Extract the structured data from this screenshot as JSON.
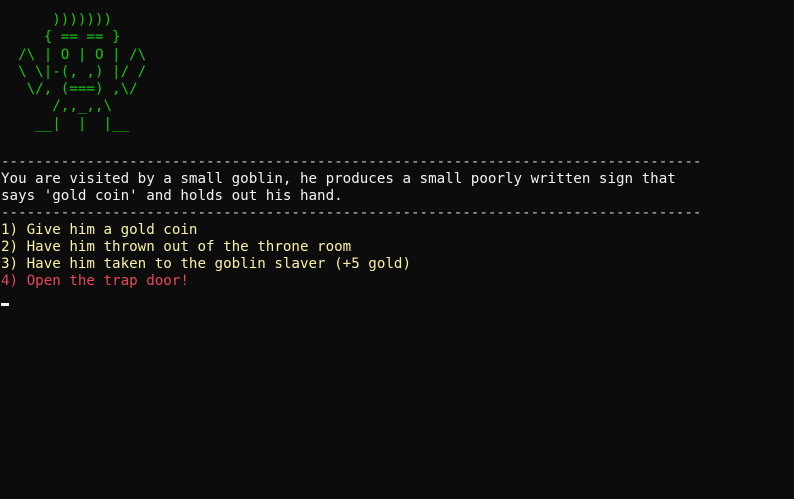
{
  "ascii_art": [
    "      )))))))",
    "     { == == }",
    "  /\\ | O | O | /\\",
    "  \\ \\|-(, ,) |/ /",
    "   \\/, (===) ,\\/",
    "      /,,_,,\\",
    "    __|  |  |__"
  ],
  "divider": "----------------------------------------------------------------------------------",
  "narrative": [
    "You are visited by a small goblin, he produces a small poorly written sign that",
    "says 'gold coin' and holds out his hand."
  ],
  "options": [
    "1) Give him a gold coin",
    "2) Have him thrown out of the throne room",
    "3) Have him taken to the goblin slaver (+5 gold)",
    "4) Open the trap door!"
  ],
  "colors": {
    "background": "#0c0c0c",
    "art": "#16c60c",
    "text": "#f2f2f2",
    "option": "#f9f1a5",
    "danger_option": "#e74856"
  },
  "icons": {
    "cursor": "text-cursor-icon"
  }
}
